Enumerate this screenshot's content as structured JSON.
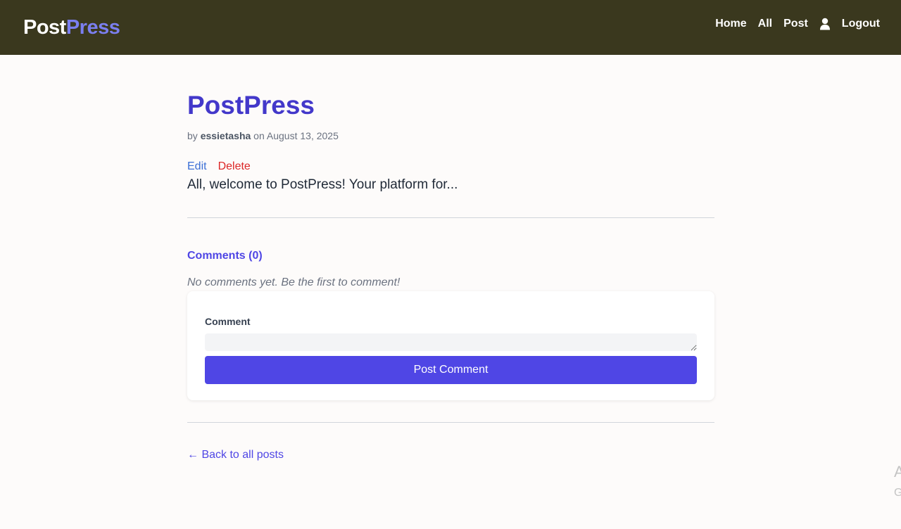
{
  "nav": {
    "brand_part1": "Post",
    "brand_part2": "Press",
    "links": {
      "home": "Home",
      "all": "All",
      "post": "Post",
      "logout": "Logout"
    },
    "user_icon": "user-icon"
  },
  "post": {
    "title": "PostPress",
    "meta_by": "by ",
    "author": "essietasha",
    "meta_on": " on ",
    "date": "August 13, 2025",
    "edit_label": "Edit",
    "delete_label": "Delete",
    "body": "All, welcome to PostPress! Your platform for..."
  },
  "comments": {
    "heading": "Comments (0)",
    "empty_message": "No comments yet. Be the first to comment!",
    "form": {
      "label": "Comment",
      "value": "",
      "submit_label": "Post Comment"
    }
  },
  "footer": {
    "back_link": "← Back to all posts"
  },
  "edge_overlay": {
    "line1": "A",
    "line2": "G"
  },
  "colors": {
    "navbar_bg": "#3a381e",
    "brand_accent": "#7b7ff0",
    "title": "#4338ca",
    "primary": "#4f46e5",
    "edit": "#3b6fd6",
    "delete": "#dc2626",
    "page_bg": "#fdfbfa"
  }
}
